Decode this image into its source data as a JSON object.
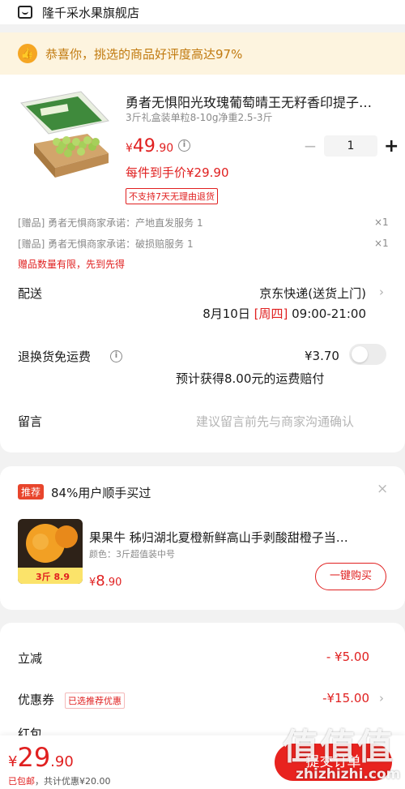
{
  "store": {
    "name": "隆千采水果旗舰店",
    "icon": "store-icon"
  },
  "praise": {
    "text": "恭喜你，挑选的商品好评度高达97%",
    "icon": "thumbs-up-icon"
  },
  "product": {
    "title": "勇者无惧阳光玫瑰葡萄晴王无籽香印提子…",
    "spec": "3斤礼盒装单粒8-10g净重2.5-3斤",
    "price_symbol": "¥",
    "price_int": "49",
    "price_dec": ".90",
    "quantity": "1",
    "minus": "−",
    "plus": "+",
    "unit_price": "每件到手价¥29.90",
    "no_return": "不支持7天无理由退货"
  },
  "gifts": [
    {
      "text": "[赠品]   勇者无惧商家承诺：产地直发服务 1",
      "count": "×1"
    },
    {
      "text": "[赠品]   勇者无惧商家承诺：破损赔服务 1",
      "count": "×1"
    }
  ],
  "gift_limit": "赠品数量有限，先到先得",
  "delivery": {
    "label": "配送",
    "method": "京东快递(送货上门)",
    "date": "8月10日",
    "weekday": "[周四]",
    "time": "09:00-21:00"
  },
  "return_shipping": {
    "label": "退换货免运费",
    "price": "¥3.70",
    "note": "预计获得8.00元的运费赔付",
    "enabled": false
  },
  "message": {
    "label": "留言",
    "placeholder": "建议留言前先与商家沟通确认"
  },
  "recommend": {
    "tag": "推荐",
    "title": "84%用户顺手买过",
    "close": "×",
    "name": "果果牛 秭归湖北夏橙新鲜高山手剥酸甜橙子当…",
    "spec": "颜色：3斤超值装中号",
    "price_symbol": "¥",
    "price_int": "8",
    "price_dec": ".90",
    "buy_label": "一键购买",
    "img_badge": "3斤 8.9"
  },
  "discounts": [
    {
      "label": "立减",
      "value": "- ¥5.00"
    },
    {
      "label": "优惠券",
      "value": "-¥15.00",
      "badge": "已选推荐优惠"
    },
    {
      "label": "红包"
    }
  ],
  "bottom": {
    "price_symbol": "¥",
    "total_int": "29",
    "total_dec": ".90",
    "shipping": "已包邮",
    "saved": "共计优惠¥20.00",
    "submit": "提交订单"
  },
  "watermark": {
    "big": "值值值",
    "small": "zhizhizhi.com"
  },
  "colors": {
    "accent": "#e02020",
    "submit_bg": "#e8231f",
    "praise_bg": "#fdf4df",
    "praise_text": "#c17a0f"
  }
}
